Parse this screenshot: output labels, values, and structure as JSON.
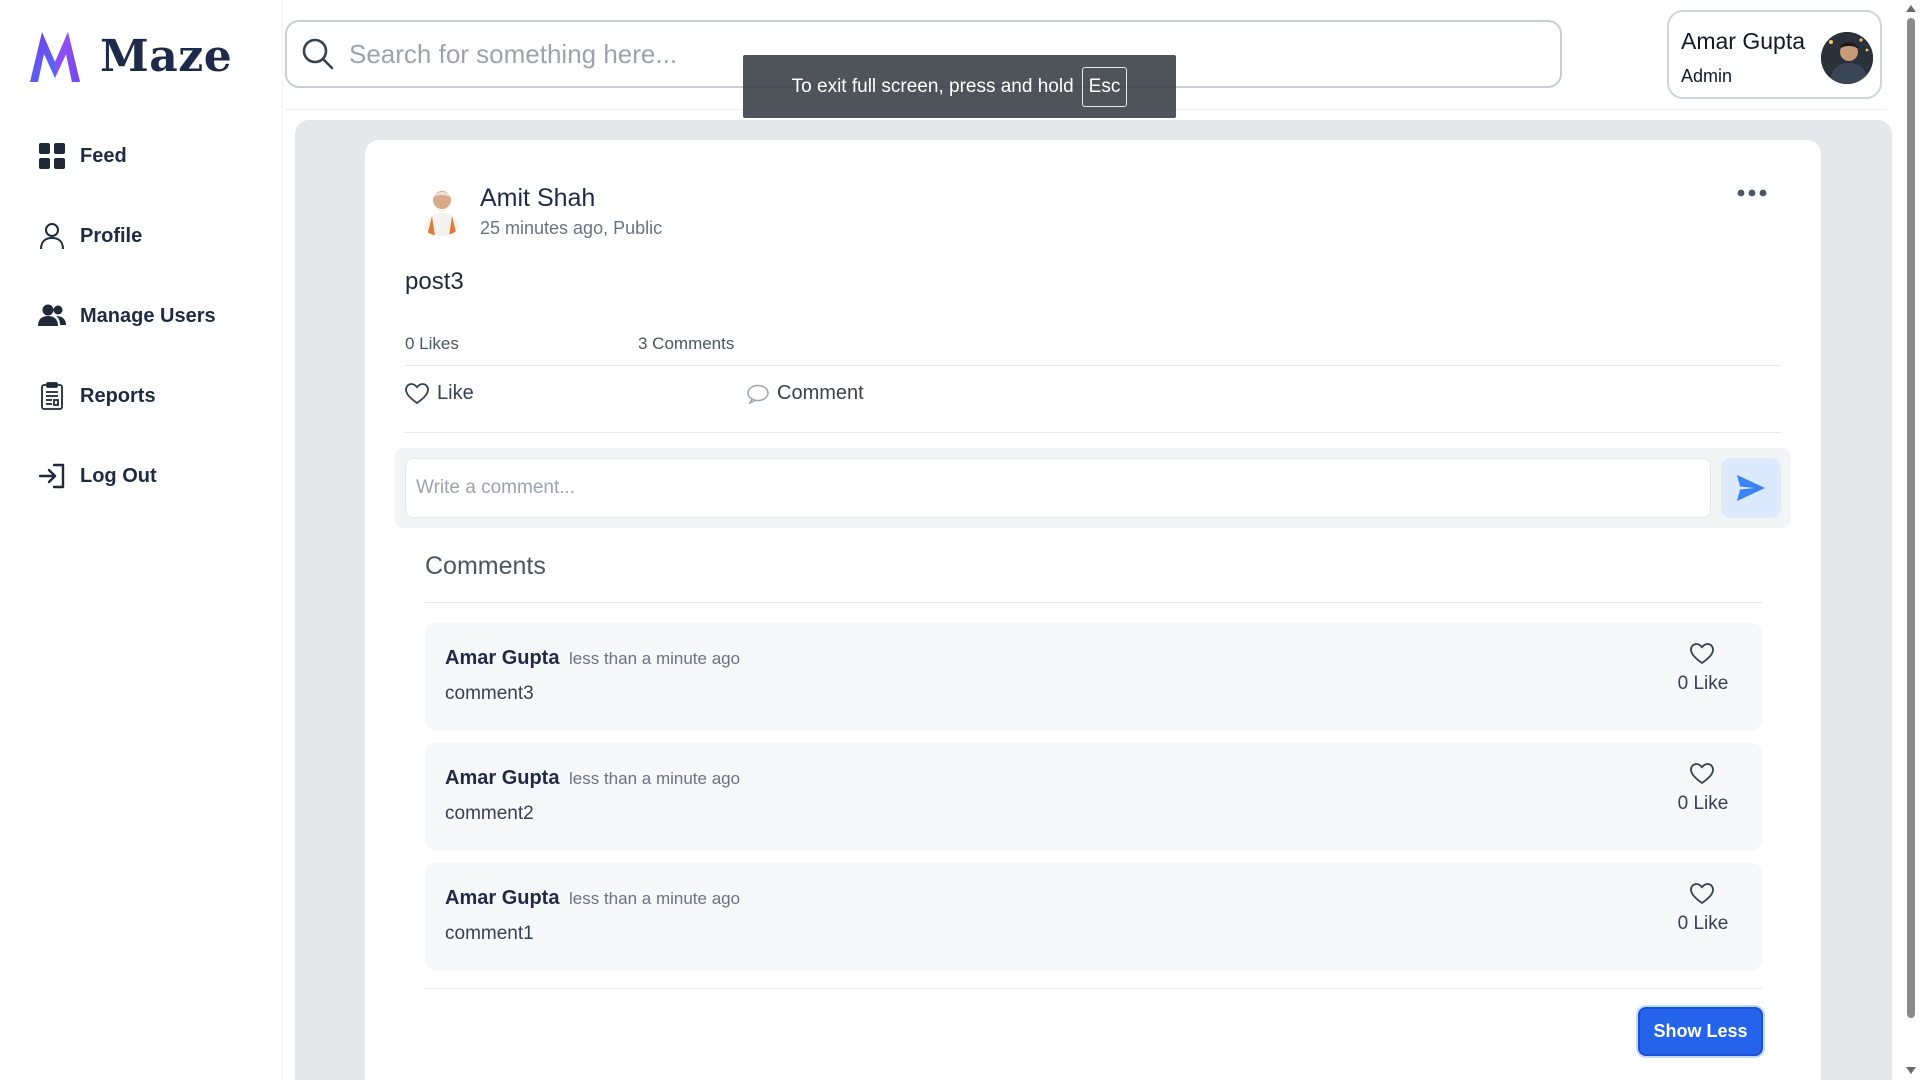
{
  "app": {
    "name": "Maze"
  },
  "colors": {
    "accent": "#2563eb",
    "logo_purple": "#7c3aed",
    "logo_blue": "#3b82f6",
    "background": "#e5e7eb"
  },
  "sidebar": {
    "items": [
      {
        "label": "Feed",
        "icon": "grid-icon"
      },
      {
        "label": "Profile",
        "icon": "user-icon"
      },
      {
        "label": "Manage Users",
        "icon": "users-icon"
      },
      {
        "label": "Reports",
        "icon": "clipboard-icon"
      },
      {
        "label": "Log Out",
        "icon": "logout-icon"
      }
    ]
  },
  "header": {
    "search_placeholder": "Search for something here...",
    "user": {
      "name": "Amar Gupta",
      "role": "Admin"
    }
  },
  "fullscreen_notice": {
    "text": "To exit full screen, press and hold",
    "key": "Esc"
  },
  "post": {
    "author": "Amit Shah",
    "meta": "25 minutes ago, Public",
    "content": "post3",
    "likes_label": "0 Likes",
    "comments_label": "3 Comments",
    "like_button": "Like",
    "comment_button": "Comment",
    "comment_placeholder": "Write a comment...",
    "comments_heading": "Comments",
    "comments": [
      {
        "author": "Amar Gupta",
        "time": "less than a minute ago",
        "text": "comment3",
        "likes": "0 Like"
      },
      {
        "author": "Amar Gupta",
        "time": "less than a minute ago",
        "text": "comment2",
        "likes": "0 Like"
      },
      {
        "author": "Amar Gupta",
        "time": "less than a minute ago",
        "text": "comment1",
        "likes": "0 Like"
      }
    ],
    "show_less_button": "Show Less"
  }
}
